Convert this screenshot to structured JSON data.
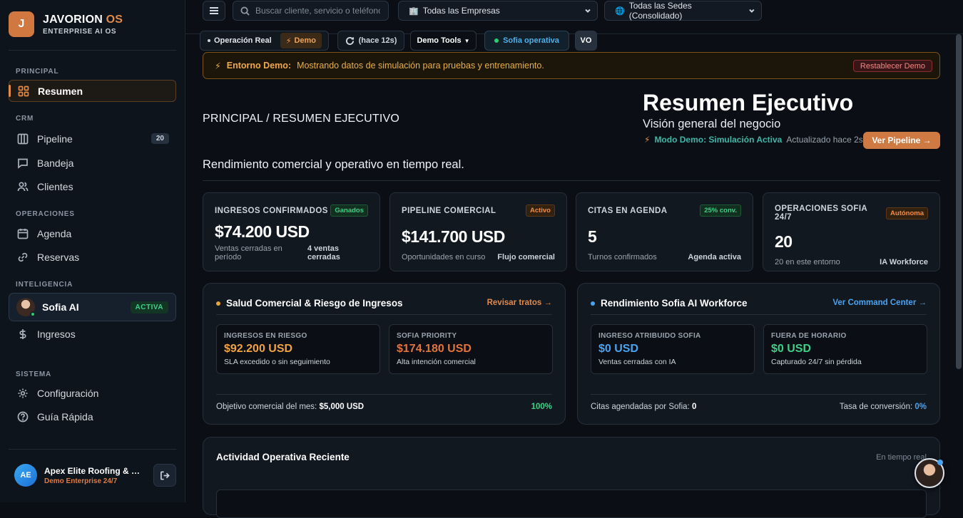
{
  "brand": {
    "logo_letter": "J",
    "name": "JAVORION",
    "name_suffix": "OS",
    "subtitle": "ENTERPRISE AI OS",
    "accent": "#d07840"
  },
  "sidebar": {
    "sections": {
      "principal": "PRINCIPAL",
      "crm": "CRM",
      "operaciones": "OPERACIONES",
      "inteligencia": "INTELIGENCIA",
      "sistema": "SISTEMA"
    },
    "items": {
      "resumen": {
        "label": "Resumen",
        "icon": "grid-icon"
      },
      "pipeline": {
        "label": "Pipeline",
        "icon": "columns-icon",
        "badge": "20"
      },
      "bandeja": {
        "label": "Bandeja",
        "icon": "chat-icon"
      },
      "clientes": {
        "label": "Clientes",
        "icon": "users-icon"
      },
      "agenda": {
        "label": "Agenda",
        "icon": "calendar-icon"
      },
      "reservas": {
        "label": "Reservas",
        "icon": "link-icon"
      },
      "sofia": {
        "label": "Sofia AI",
        "badge": "ACTIVA",
        "icon": "avatar"
      },
      "ingresos": {
        "label": "Ingresos",
        "icon": "dollar-icon"
      },
      "configuracion": {
        "label": "Configuración",
        "icon": "gear-icon"
      },
      "guia": {
        "label": "Guía Rápida",
        "icon": "help-icon"
      }
    },
    "account": {
      "initials": "AE",
      "name": "Apex Elite Roofing & Construction",
      "plan": "Demo Enterprise 24/7"
    }
  },
  "topbar": {
    "search_placeholder": "Buscar cliente, servicio o teléfono",
    "company_select": "Todas las Empresas",
    "site_select": "Todas las Sedes (Consolidado)"
  },
  "toolbar": {
    "mode_real": "Operación Real",
    "mode_demo": "Demo",
    "refresh": "(hace 12s)",
    "demo_tools": "Demo Tools",
    "sofia_status": "Sofia operativa",
    "user_initials": "VO"
  },
  "banner": {
    "label": "Entorno Demo:",
    "text": "Mostrando datos de simulación para pruebas y entrenamiento.",
    "reset": "Restablecer Demo"
  },
  "header": {
    "breadcrumb": "PRINCIPAL / RESUMEN EJECUTIVO",
    "title": "Resumen Ejecutivo",
    "subtitle": "Visión general del negocio",
    "mode": "Modo Demo: Simulación Activa",
    "updated": "Actualizado hace 2s",
    "pipeline_button": "Ver Pipeline →",
    "tagline": "Rendimiento comercial y operativo en tiempo real."
  },
  "kpis": [
    {
      "title": "INGRESOS CONFIRMADOS",
      "tag": "Ganados",
      "value": "$74.200 USD",
      "left": "Ventas cerradas en período",
      "right": "4 ventas cerradas"
    },
    {
      "title": "PIPELINE COMERCIAL",
      "tag": "Activo",
      "value": "$141.700 USD",
      "left": "Oportunidades en curso",
      "right": "Flujo comercial"
    },
    {
      "title": "CITAS EN AGENDA",
      "tag": "25% conv.",
      "value": "5",
      "left": "Turnos confirmados",
      "right": "Agenda activa"
    },
    {
      "title": "OPERACIONES SOFIA 24/7",
      "tag": "Autónoma",
      "value": "20",
      "left": "20 en este entorno",
      "right": "IA Workforce"
    }
  ],
  "health": {
    "title": "Salud Comercial & Riesgo de Ingresos",
    "link": "Revisar tratos →",
    "m1": {
      "label": "INGRESOS EN RIESGO",
      "value": "$92.200 USD",
      "sub": "SLA excedido o sin seguimiento"
    },
    "m2": {
      "label": "SOFIA PRIORITY",
      "value": "$174.180 USD",
      "sub": "Alta intención comercial"
    },
    "foot_label": "Objetivo comercial del mes:",
    "foot_value": "$5,000 USD",
    "foot_percent": "100%"
  },
  "sofia_perf": {
    "title": "Rendimiento Sofia AI Workforce",
    "link": "Ver Command Center →",
    "m1": {
      "label": "INGRESO ATRIBUIDO SOFIA",
      "value": "$0 USD",
      "sub": "Ventas cerradas con IA"
    },
    "m2": {
      "label": "FUERA DE HORARIO",
      "value": "$0 USD",
      "sub": "Capturado 24/7 sin pérdida"
    },
    "foot_left_label": "Citas agendadas por Sofia:",
    "foot_left_value": "0",
    "foot_right_label": "Tasa de conversión:",
    "foot_right_value": "0%"
  },
  "activity": {
    "title": "Actividad Operativa Reciente",
    "live": "En tiempo real"
  }
}
